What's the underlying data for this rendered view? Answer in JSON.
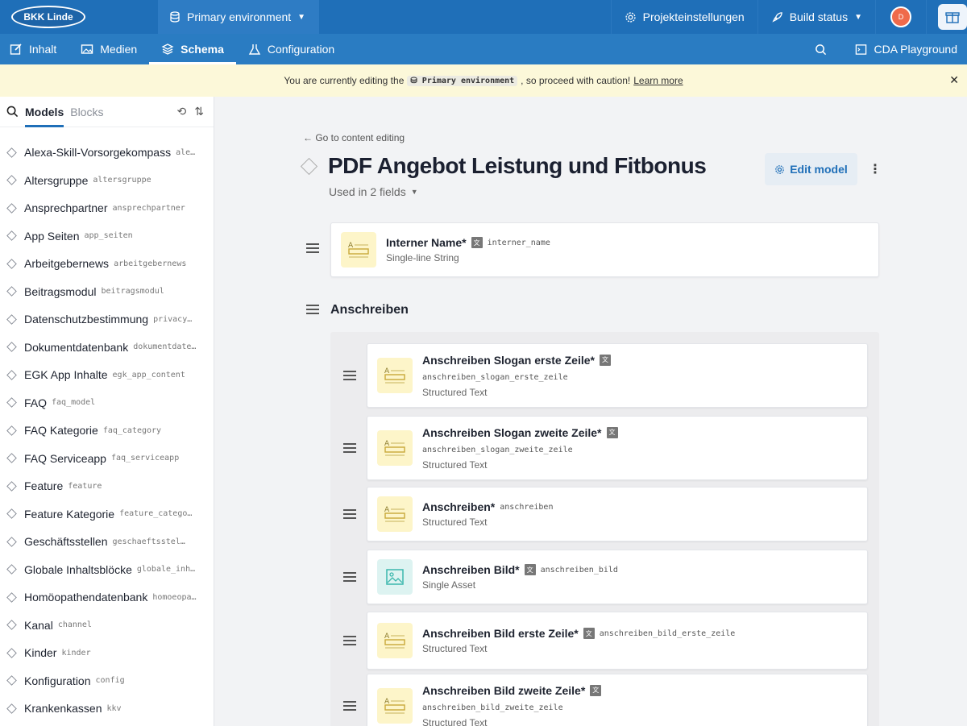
{
  "topbar": {
    "logo_text": "BKK Linde",
    "environment_label": "Primary environment",
    "project_settings": "Projekteinstellungen",
    "build_status": "Build status",
    "avatar_initial": "D"
  },
  "nav": {
    "items": [
      {
        "label": "Inhalt",
        "icon": "edit-icon"
      },
      {
        "label": "Medien",
        "icon": "image-icon"
      },
      {
        "label": "Schema",
        "icon": "layers-icon",
        "active": true
      },
      {
        "label": "Configuration",
        "icon": "flask-icon"
      }
    ],
    "cda_playground": "CDA Playground"
  },
  "banner": {
    "prefix": "You are currently editing the",
    "env_code": "Primary environment",
    "suffix": ", so proceed with caution!",
    "link": "Learn more"
  },
  "sidebar": {
    "tab_models": "Models",
    "tab_blocks": "Blocks",
    "models": [
      {
        "name": "Alexa-Skill-Vorsorgekompass",
        "api": "ale…"
      },
      {
        "name": "Altersgruppe",
        "api": "altersgruppe"
      },
      {
        "name": "Ansprechpartner",
        "api": "ansprechpartner"
      },
      {
        "name": "App Seiten",
        "api": "app_seiten"
      },
      {
        "name": "Arbeitgebernews",
        "api": "arbeitgebernews"
      },
      {
        "name": "Beitragsmodul",
        "api": "beitragsmodul"
      },
      {
        "name": "Datenschutzbestimmung",
        "api": "privacy…"
      },
      {
        "name": "Dokumentdatenbank",
        "api": "dokumentdate…"
      },
      {
        "name": "EGK App Inhalte",
        "api": "egk_app_content"
      },
      {
        "name": "FAQ",
        "api": "faq_model"
      },
      {
        "name": "FAQ Kategorie",
        "api": "faq_category"
      },
      {
        "name": "FAQ Serviceapp",
        "api": "faq_serviceapp"
      },
      {
        "name": "Feature",
        "api": "feature"
      },
      {
        "name": "Feature Kategorie",
        "api": "feature_category"
      },
      {
        "name": "Geschäftsstellen",
        "api": "geschaeftsstellen"
      },
      {
        "name": "Globale Inhaltsblöcke",
        "api": "globale_inh…"
      },
      {
        "name": "Homöopathendatenbank",
        "api": "homoeopa…"
      },
      {
        "name": "Kanal",
        "api": "channel"
      },
      {
        "name": "Kinder",
        "api": "kinder"
      },
      {
        "name": "Konfiguration",
        "api": "config"
      },
      {
        "name": "Krankenkassen",
        "api": "kkv"
      }
    ]
  },
  "main": {
    "back_link": "← Go to content editing",
    "title": "PDF Angebot Leistung und Fitbonus",
    "used_in": "Used in 2 fields",
    "edit_model": "Edit model",
    "top_field": {
      "name": "Interner Name*",
      "api": "interner_name",
      "type": "Single-line String",
      "localized": true
    },
    "group_title": "Anschreiben",
    "group_fields": [
      {
        "name": "Anschreiben Slogan erste Zeile*",
        "api": "anschreiben_slogan_erste_zeile",
        "type": "Structured Text",
        "localized": true,
        "icon": "text-field-icon",
        "api_inline": false
      },
      {
        "name": "Anschreiben Slogan zweite Zeile*",
        "api": "anschreiben_slogan_zweite_zeile",
        "type": "Structured Text",
        "localized": true,
        "icon": "text-field-icon",
        "api_inline": false
      },
      {
        "name": "Anschreiben*",
        "api": "anschreiben",
        "type": "Structured Text",
        "localized": false,
        "icon": "text-field-icon",
        "api_inline": true
      },
      {
        "name": "Anschreiben Bild*",
        "api": "anschreiben_bild",
        "type": "Single Asset",
        "localized": true,
        "icon": "image-field-icon",
        "api_inline": true
      },
      {
        "name": "Anschreiben Bild erste Zeile*",
        "api": "anschreiben_bild_erste_zeile",
        "type": "Structured Text",
        "localized": true,
        "icon": "text-field-icon",
        "api_inline": true
      },
      {
        "name": "Anschreiben Bild zweite Zeile*",
        "api": "anschreiben_bild_zweite_zeile",
        "type": "Structured Text",
        "localized": true,
        "icon": "text-field-icon",
        "api_inline": false
      }
    ]
  },
  "colors": {
    "brand": "#1f6fb8",
    "nav": "#2a7cc2",
    "banner": "#fcf8d9"
  }
}
